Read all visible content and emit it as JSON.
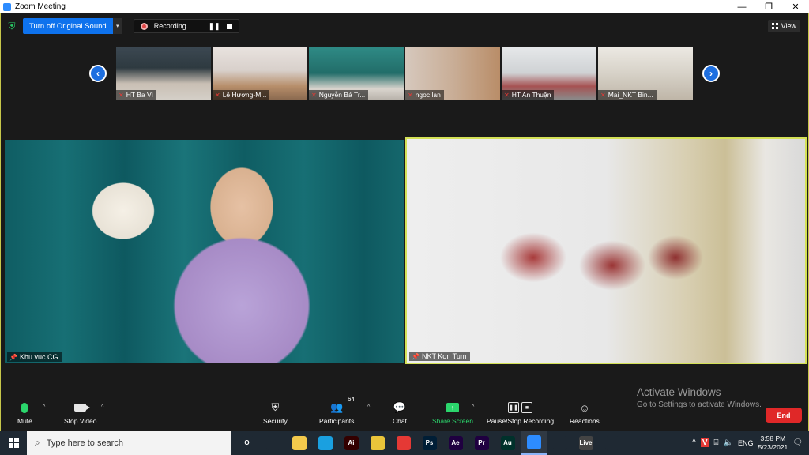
{
  "window": {
    "title": "Zoom Meeting"
  },
  "topbar": {
    "original_sound_label": "Turn off Original Sound",
    "recording_label": "Recording...",
    "view_label": "View"
  },
  "thumbnails": [
    {
      "name": "HT Ba Vì"
    },
    {
      "name": "Lê Hương-M..."
    },
    {
      "name": "Nguyễn Bá Tr..."
    },
    {
      "name": "ngoc lan"
    },
    {
      "name": "HT An Thuận"
    },
    {
      "name": "Mai_NKT Bin..."
    }
  ],
  "videos": {
    "left": {
      "name": "Khu vuc CG"
    },
    "right": {
      "name": "NKT Kon Tum"
    }
  },
  "watermark": {
    "line1": "Activate Windows",
    "line2": "Go to Settings to activate Windows."
  },
  "toolbar": {
    "mute": "Mute",
    "stop_video": "Stop Video",
    "security": "Security",
    "participants": "Participants",
    "participant_count": "64",
    "chat": "Chat",
    "share_screen": "Share Screen",
    "pause_stop_recording": "Pause/Stop Recording",
    "reactions": "Reactions",
    "end": "End"
  },
  "taskbar": {
    "search_placeholder": "Type here to search",
    "language": "ENG",
    "time": "3:58 PM",
    "date": "5/23/2021",
    "apps": [
      {
        "icon": "circle-icon",
        "label": "O",
        "color": "#1f2933"
      },
      {
        "icon": "task-view-icon",
        "label": "",
        "color": "#1f2933"
      },
      {
        "icon": "file-explorer-icon",
        "label": "",
        "color": "#f2c94c"
      },
      {
        "icon": "edge-icon",
        "label": "",
        "color": "#1aa0e0"
      },
      {
        "icon": "illustrator-icon",
        "label": "Ai",
        "color": "#330000"
      },
      {
        "icon": "chrome-icon",
        "label": "",
        "color": "#e9c43a"
      },
      {
        "icon": "app-red-icon",
        "label": "",
        "color": "#e53935"
      },
      {
        "icon": "photoshop-icon",
        "label": "Ps",
        "color": "#001e36"
      },
      {
        "icon": "after-effects-icon",
        "label": "Ae",
        "color": "#1f0040"
      },
      {
        "icon": "premiere-icon",
        "label": "Pr",
        "color": "#1f0040"
      },
      {
        "icon": "audition-icon",
        "label": "Au",
        "color": "#00312b"
      },
      {
        "icon": "zoom-icon",
        "label": "",
        "color": "#2d8cff"
      },
      {
        "icon": "app-circle-icon",
        "label": "",
        "color": "#1f2933"
      },
      {
        "icon": "livestream-icon",
        "label": "Live",
        "color": "#444"
      },
      {
        "icon": "app-messenger-icon",
        "label": "",
        "color": "#1f2933"
      }
    ]
  },
  "colors": {
    "accent": "#0e72ed",
    "speaker_border": "#d4e157",
    "end": "#e02828",
    "share": "#2bd66c"
  }
}
